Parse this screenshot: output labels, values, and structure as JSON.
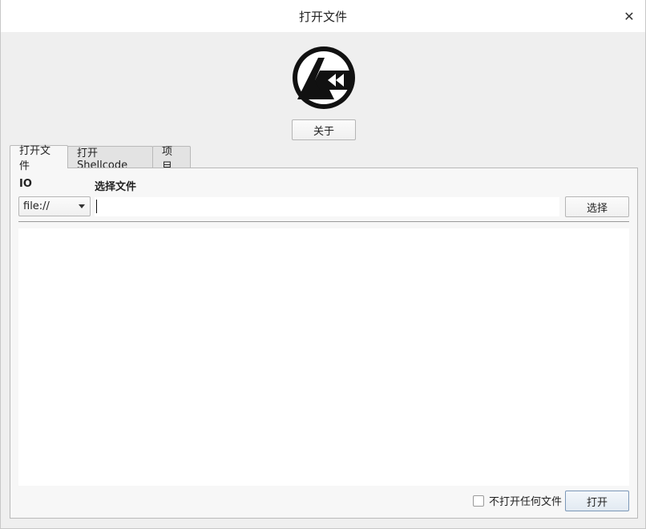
{
  "window": {
    "title": "打开文件",
    "close_icon": "close-icon"
  },
  "logo": {
    "icon": "app-logo-icon"
  },
  "about_button": "关于",
  "tabs": [
    {
      "label": "打开文件",
      "active": true
    },
    {
      "label": "打开 Shellcode",
      "active": false
    },
    {
      "label": "项目",
      "active": false
    }
  ],
  "form": {
    "io_label": "IO",
    "file_label": "选择文件",
    "io_value": "file://",
    "path_value": "",
    "choose_button": "选择"
  },
  "footer": {
    "no_open_label": "不打开任何文件",
    "no_open_checked": false,
    "open_button": "打开"
  },
  "colors": {
    "window_bg": "#efefef",
    "panel_bg": "#f7f7f7",
    "primary_border": "#7c98b8"
  }
}
